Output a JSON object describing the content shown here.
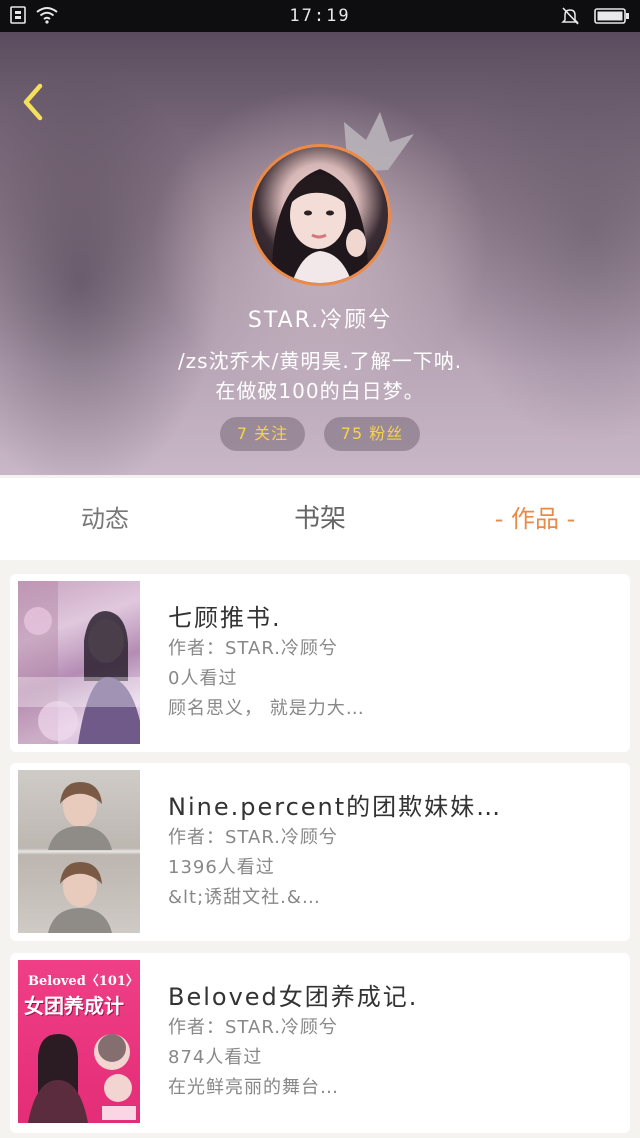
{
  "status_bar": {
    "time": "17:19"
  },
  "profile": {
    "username": "STAR.冷顾兮",
    "bio_line1": "/zs沈乔木/黄明昊.了解一下呐.",
    "bio_line2": "在做破100的白日梦。",
    "following": "7 关注",
    "fans": "75 粉丝"
  },
  "tabs": {
    "dynamics": "动态",
    "bookshelf": "书架",
    "works": "- 作品 -",
    "active": "works"
  },
  "works": [
    {
      "title": "七顾推书.",
      "author": "作者：STAR.冷顾兮",
      "reads": "0人看过",
      "desc": "顾名思义， 就是力大…"
    },
    {
      "title": "Nine.percent的团欺妹妹…",
      "author": "作者：STAR.冷顾兮",
      "reads": "1396人看过",
      "desc": "&lt;诱甜文社.&…"
    },
    {
      "title": "Beloved女团养成记.",
      "author": "作者：STAR.冷顾兮",
      "reads": "874人看过",
      "desc": "在光鲜亮丽的舞台…"
    }
  ],
  "cover3_text": {
    "top": "Beloved〈101〉",
    "main": "女团养成计"
  },
  "colors": {
    "accent": "#e98a45",
    "pill_text": "#f7d24a",
    "avatar_ring": "#ec8a4a"
  }
}
